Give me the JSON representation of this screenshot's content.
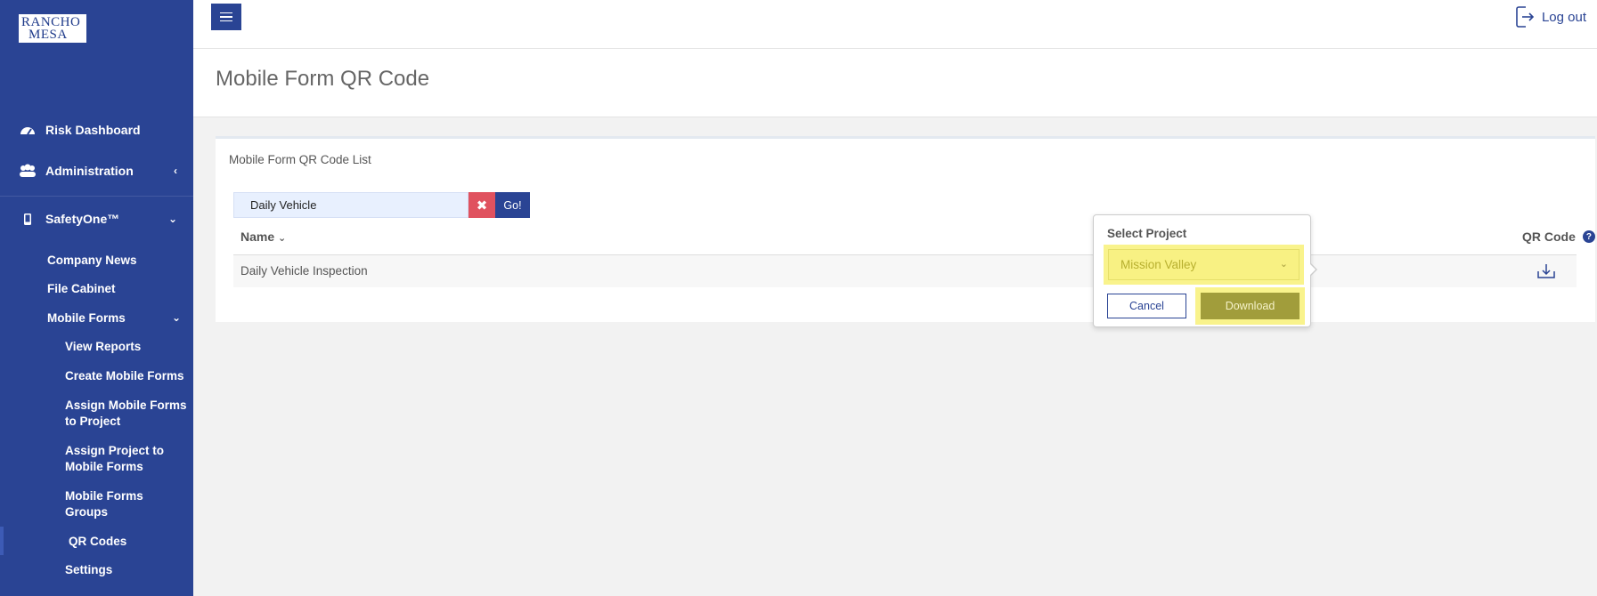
{
  "brand": {
    "logo_line1": "RANCHO",
    "logo_line2": "MESA"
  },
  "header": {
    "logout_label": "Log out"
  },
  "sidebar": {
    "items": [
      {
        "label": "Risk Dashboard",
        "icon": "gauge-icon"
      },
      {
        "label": "Administration",
        "icon": "users-icon"
      },
      {
        "label": "SafetyOne™",
        "icon": "mobile-icon"
      }
    ],
    "safetyone_items": [
      "Company News",
      "File Cabinet",
      "Mobile Forms"
    ],
    "mobile_forms_items": [
      "View Reports",
      "Create Mobile Forms",
      "Assign Mobile Forms to Project",
      "Assign Project to Mobile Forms",
      "Mobile Forms Groups",
      "QR Codes",
      "Settings"
    ]
  },
  "page": {
    "title": "Mobile Form QR Code"
  },
  "card": {
    "title": "Mobile Form QR Code List",
    "search": {
      "value": "Daily Vehicle",
      "go_label": "Go!"
    },
    "columns": {
      "name": "Name",
      "qr_code": "QR Code"
    },
    "rows": [
      {
        "name": "Daily Vehicle Inspection"
      }
    ]
  },
  "popover": {
    "title": "Select Project",
    "selected_project": "Mission Valley",
    "cancel_label": "Cancel",
    "download_label": "Download"
  },
  "colors": {
    "primary": "#2a4494",
    "danger": "#e0525f",
    "highlight": "#f9f38c"
  }
}
